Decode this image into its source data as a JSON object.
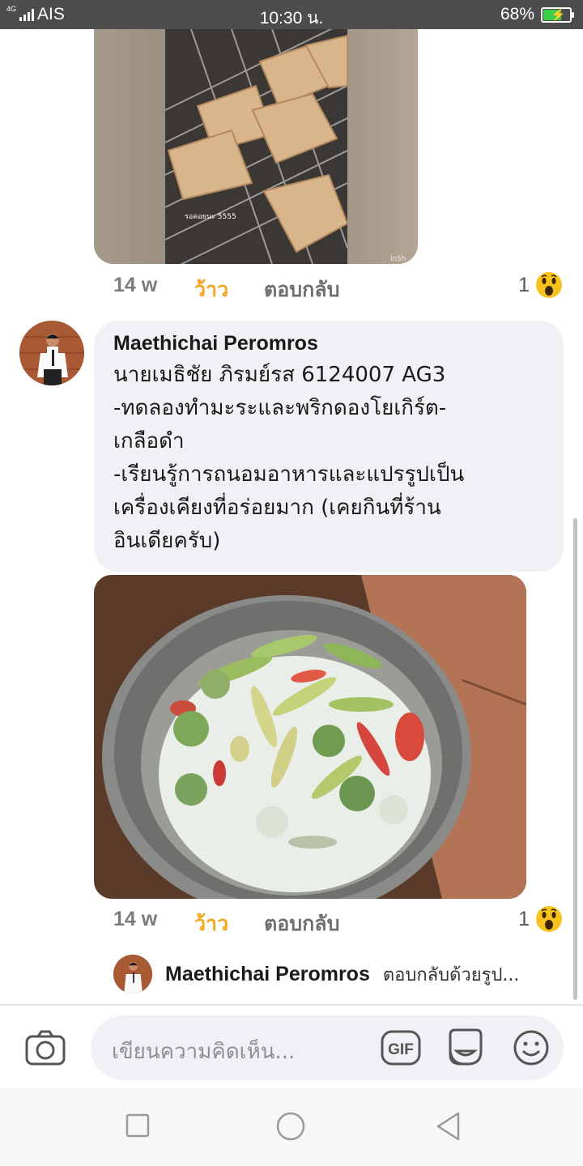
{
  "status_bar": {
    "network_type": "4G",
    "carrier": "AIS",
    "time": "10:30 น.",
    "battery_percent": "68%",
    "battery_level": 0.68,
    "battery_color": "#3ecf4a"
  },
  "comments": [
    {
      "media": {
        "overlay_caption": "รอคอยนะ 5555",
        "watermark": "inSh"
      },
      "time": "14 w",
      "react_label": "ว้าว",
      "reply_label": "ตอบกลับ",
      "reaction_count": "1",
      "reaction_icon": "wow-emoji"
    },
    {
      "author": "Maethichai Peromros",
      "lines": [
        "นายเมธิชัย ภิรมย์รส 6124007 AG3",
        "-ทดลองทำมะระและพริกดองโยเกิร์ต-",
        "เกลือดำ",
        "-เรียนรู้การถนอมอาหารและแปรรูปเป็น",
        "เครื่องเคียงที่อร่อยมาก (เคยกินที่ร้าน",
        "อินเดียครับ)"
      ],
      "time": "14 w",
      "react_label": "ว้าว",
      "reply_label": "ตอบกลับ",
      "reaction_count": "1",
      "reaction_icon": "wow-emoji",
      "reply_preview": {
        "author": "Maethichai Peromros",
        "snippet": "ตอบกลับด้วยรูป..."
      }
    }
  ],
  "composer": {
    "placeholder": "เขียนความคิดเห็น...",
    "gif_label": "GIF",
    "icons": [
      "camera-icon",
      "gif-icon",
      "sticker-icon",
      "emoji-icon"
    ]
  },
  "navigation": {
    "icons": [
      "recent-apps-icon",
      "home-icon",
      "back-icon"
    ]
  },
  "colors": {
    "react_accent": "#f5a623",
    "bubble_bg": "#f0f1f4",
    "statusbar_bg": "#4d4d4d"
  }
}
